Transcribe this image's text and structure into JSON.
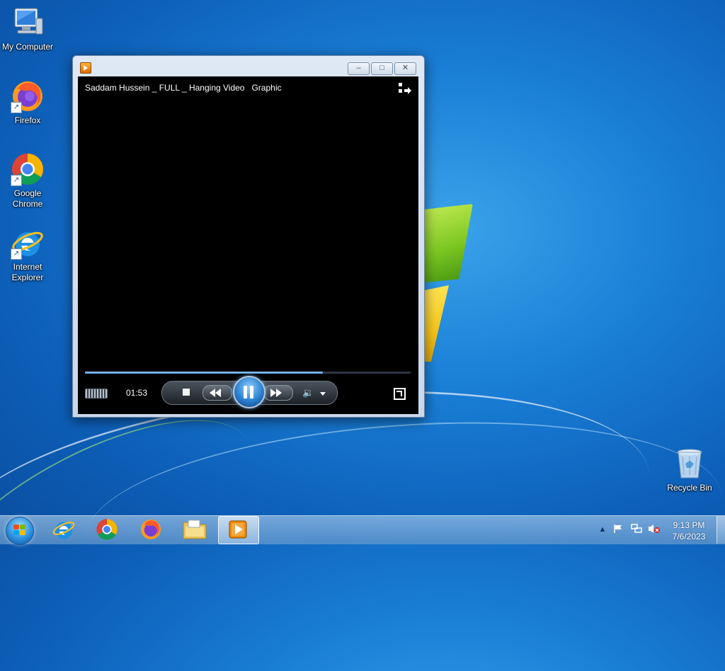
{
  "desktop": {
    "icons": [
      {
        "label": "My Computer"
      },
      {
        "label": "Firefox"
      },
      {
        "label": "Google Chrome"
      },
      {
        "label": "Internet Explorer"
      },
      {
        "label": "Recycle Bin"
      }
    ]
  },
  "player": {
    "video_title": "Saddam Hussein _ FULL _ Hanging Video   Graphic",
    "elapsed_time": "01:53",
    "progress_fraction": 0.73,
    "window_buttons": {
      "minimize": "–",
      "maximize": "□",
      "close": "✕"
    },
    "icons": {
      "app": "media-player-icon",
      "switch_to_library": "switch-to-library-icon",
      "stop": "stop-icon",
      "previous": "rewind-icon",
      "play_pause": "pause-icon",
      "next": "fast-forward-icon",
      "mute": "speaker-icon",
      "fullscreen": "fullscreen-icon"
    },
    "mute_glyph": "🔉"
  },
  "taskbar": {
    "items": [
      "start-orb",
      "internet-explorer",
      "google-chrome",
      "firefox",
      "file-explorer",
      "windows-media-player"
    ],
    "active_item": "windows-media-player",
    "tray": {
      "overflow_glyph": "▲",
      "icons": [
        "show-hidden-icons",
        "action-center-flag-icon",
        "network-icon",
        "volume-muted-icon"
      ]
    },
    "clock_time": "9:13 PM",
    "clock_date": "7/6/2023"
  },
  "colors": {
    "accent_blue": "#2a7fd0",
    "seek_fill": "#4a8fd8",
    "taskbar_text": "#ffffff"
  }
}
